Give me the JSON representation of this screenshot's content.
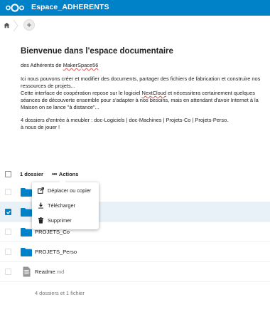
{
  "header": {
    "app_title": "Espace_ADHERENTS",
    "logo_icon": "nextcloud-logo",
    "bg_color": "#0082c9"
  },
  "breadcrumb": {
    "home_icon": "home-icon",
    "add_label": "+"
  },
  "readme": {
    "title": "Bienvenue dans l'espace documentaire",
    "intro_prefix": "des Adhérents de ",
    "intro_link": "MakerSpace56",
    "para2_line1": "Ici nous pouvons créer et modifier des documents, partager des fichiers de fabrication et construire nos",
    "para2_line2": "ressources de projets...",
    "para2_line3_prefix": "Cette interface de coopération repose sur le logiciel ",
    "para2_line3_word": "NextCloud",
    "para2_line3_suffix": " et nécessitera certainement quelques",
    "para2_line4": "séances de découverte ensemble pour s'adapter à nos besoins, mais en attendant d'avoir Internet à la",
    "para2_line5": "Maison on se lance \"à distance\"...",
    "para3_line1": "4 dossiers d'entrée à meubler : doc-Logiciels | doc-Machines | Projets-Co | Projets-Perso.",
    "para3_line2": "à nous de jouer !"
  },
  "list_header": {
    "selection_count": "1 dossier",
    "actions_label": "Actions"
  },
  "files": [
    {
      "name": "",
      "ext": "",
      "type": "folder",
      "selected": false
    },
    {
      "name": "",
      "ext": "",
      "type": "folder",
      "selected": true
    },
    {
      "name": "PROJETS_Co",
      "ext": "",
      "type": "folder",
      "selected": false
    },
    {
      "name": "PROJETS_Perso",
      "ext": "",
      "type": "folder",
      "selected": false
    },
    {
      "name": "Readme",
      "ext": ".md",
      "type": "file",
      "selected": false
    }
  ],
  "summary": "4 dossiers et 1 fichier",
  "actions_menu": {
    "items": [
      {
        "label": "Déplacer ou copier",
        "icon": "external-move-icon"
      },
      {
        "label": "Télécharger",
        "icon": "download-icon"
      },
      {
        "label": "Supprimer",
        "icon": "trash-icon"
      }
    ]
  },
  "colors": {
    "accent": "#0082c9",
    "folder": "#0082c9",
    "selected_row": "#e8f1f8"
  }
}
